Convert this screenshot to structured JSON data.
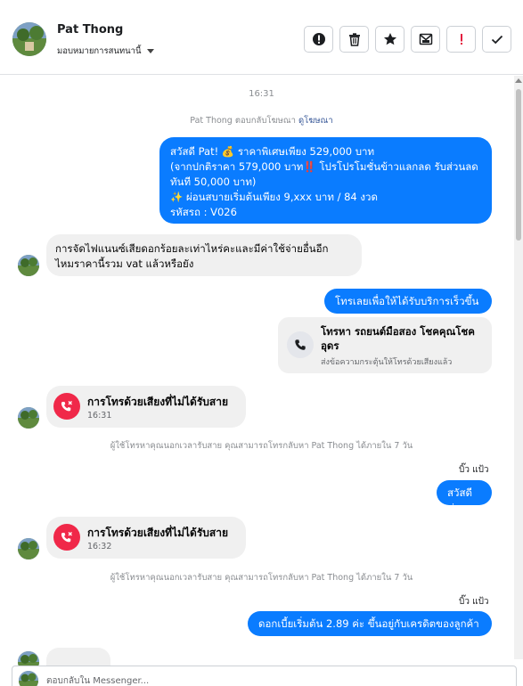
{
  "header": {
    "contact_name": "Pat Thong",
    "assign_label": "มอบหมายการสนทนานี้",
    "actions": [
      {
        "name": "report-icon",
        "color": "#1c1e21"
      },
      {
        "name": "trash-icon",
        "color": "#1c1e21"
      },
      {
        "name": "star-icon",
        "color": "#1c1e21"
      },
      {
        "name": "mark-unread-icon",
        "color": "#1c1e21"
      },
      {
        "name": "follow-up-icon",
        "color": "#e41e3f"
      },
      {
        "name": "done-check-icon",
        "color": "#1c1e21"
      }
    ]
  },
  "thread": {
    "time_1": "16:31",
    "ad_reply": {
      "prefix": "Pat Thong ตอบกลับโฆษณา",
      "link": "ดูโฆษณา"
    },
    "offer_bubble": {
      "line1": "สวัสดี Pat! 💰 ราคาพิเศษเพียง 529,000 บาท",
      "line2": "(จากปกติราคา 579,000 บาท‼️ โปรโปรโมชั่นข้าวแลกลด รับส่วนลด",
      "line3": "ทันที 50,000 บาท)",
      "line4": "✨ ผ่อนสบายเริ่มต้นเพียง 9,xxx บาท / 84 งวด",
      "line5": "รหัสรถ : V026"
    },
    "incoming_question": {
      "line1": "การจัดไฟแนนซ์เสียดอกร้อยละเท่าไหร่คะและมีค่าใช้จ่ายอื่นอีก",
      "line2": "ไหมราคานี้รวม vat แล้วหรือยัง"
    },
    "call_prompt": "โทรเลยเพื่อให้ได้รับบริการเร็วขึ้น",
    "call_card": {
      "title": "โทรหา รถยนต์มือสอง โชคคุณโชค อุดร",
      "subtitle": "ส่งข้อความกระตุ้นให้โทรด้วยเสียงแล้ว"
    },
    "missed_call_1": {
      "title": "การโทรด้วยเสียงที่ไม่ได้รับสาย",
      "time": "16:31"
    },
    "missed_note_1": "ผู้ใช้โทรหาคุณนอกเวลารับสาย คุณสามารถโทรกลับหา Pat Thong ได้ภายใน 7 วัน",
    "sender_label_1": "บิ๊ว แป้ว",
    "greeting": "สวัสดีค่ะ",
    "missed_call_2": {
      "title": "การโทรด้วยเสียงที่ไม่ได้รับสาย",
      "time": "16:32"
    },
    "missed_note_2": "ผู้ใช้โทรหาคุณนอกเวลารับสาย คุณสามารถโทรกลับหา Pat Thong ได้ภายใน 7 วัน",
    "sender_label_2": "บิ๊ว แป้ว",
    "interest_msg": "ดอกเบี้ยเริ่มต้น 2.89 ค่ะ ขึ้นอยู่กับเครดิตของลูกค้า"
  },
  "composer": {
    "placeholder": "ตอบกลับใน Messenger..."
  },
  "colors": {
    "outgoing": "#0a7cff",
    "incoming": "#f0f0f0",
    "missed_call": "#f02849"
  }
}
